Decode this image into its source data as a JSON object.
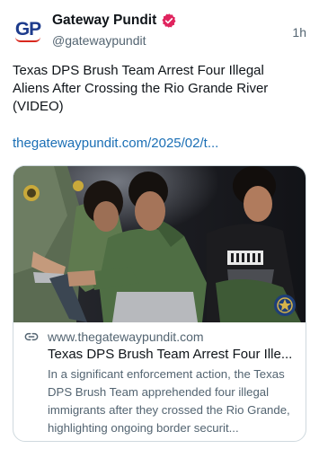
{
  "author": {
    "avatar_text": "GP",
    "display_name": "Gateway Pundit",
    "handle": "@gatewaypundit",
    "verified": true
  },
  "timestamp": "1h",
  "post": {
    "text": "Texas DPS Brush Team Arrest Four Illegal Aliens After Crossing the Rio Grande River (VIDEO)",
    "link": "thegatewaypundit.com/2025/02/t..."
  },
  "card": {
    "domain": "www.thegatewaypundit.com",
    "title": "Texas DPS Brush Team Arrest Four Ille...",
    "description": "In a significant enforcement action, the Texas DPS Brush Team apprehended four illegal immigrants after they crossed the Rio Grande, highlighting ongoing border securit..."
  },
  "colors": {
    "link": "#1b6fb5",
    "verified_badge": "#e0245e",
    "secondary_text": "#536471",
    "card_border": "#cfd9de"
  },
  "icons": {
    "verified": "verified-badge-icon",
    "link": "link-icon"
  }
}
